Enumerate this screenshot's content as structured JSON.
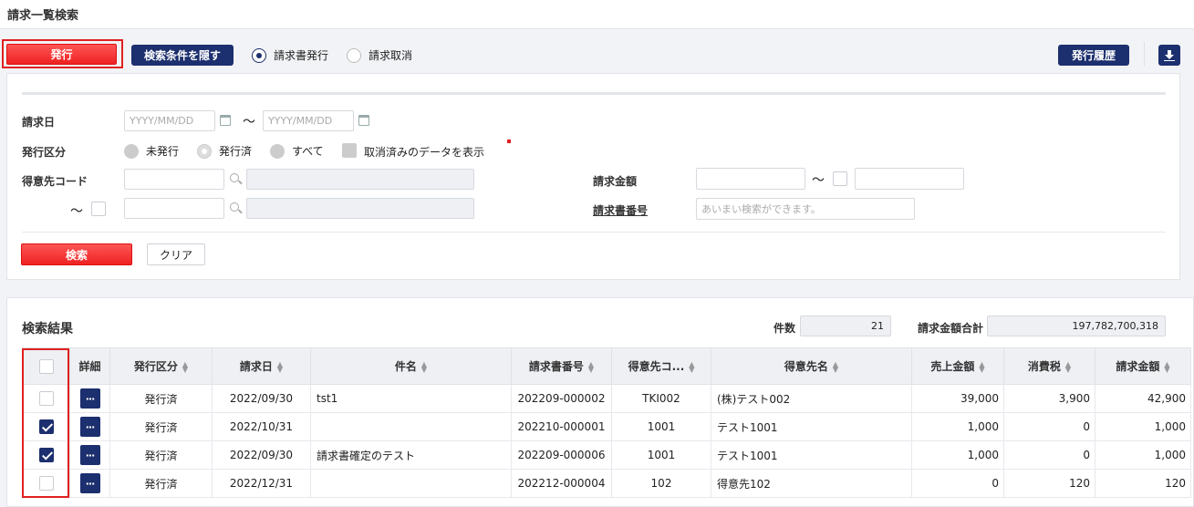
{
  "page_title": "請求一覧検索",
  "toolbar": {
    "issue_button": "発行",
    "hide_conditions_button": "検索条件を隠す",
    "mode_issue": "請求書発行",
    "mode_cancel": "請求取消",
    "history_button": "発行履歴"
  },
  "search": {
    "date_label": "請求日",
    "date_from_placeholder": "YYYY/MM/DD",
    "date_to_placeholder": "YYYY/MM/DD",
    "tilde": "〜",
    "status_label": "発行区分",
    "status_unissued": "未発行",
    "status_issued": "発行済",
    "status_all": "すべて",
    "show_cancelled": "取消済みのデータを表示",
    "customer_code_label": "得意先コード",
    "amount_label": "請求金額",
    "invoice_no_label": "請求書番号",
    "invoice_no_placeholder": "あいまい検索ができます。",
    "search_button": "検索",
    "clear_button": "クリア"
  },
  "results": {
    "title": "検索結果",
    "count_label": "件数",
    "count_value": "21",
    "total_label": "請求金額合計",
    "total_value": "197,782,700,318",
    "columns": [
      "詳細",
      "発行区分",
      "請求日",
      "件名",
      "請求書番号",
      "得意先コ...",
      "得意先名",
      "売上金額",
      "消費税",
      "請求金額"
    ],
    "rows": [
      {
        "checked": false,
        "status": "発行済",
        "date": "2022/09/30",
        "subject": "tst1",
        "invoice_no": "202209-000002",
        "customer_code": "TKI002",
        "customer_name": "(株)テスト002",
        "sales": "39,000",
        "tax": "3,900",
        "amount": "42,900"
      },
      {
        "checked": true,
        "status": "発行済",
        "date": "2022/10/31",
        "subject": "",
        "invoice_no": "202210-000001",
        "customer_code": "1001",
        "customer_name": "テスト1001",
        "sales": "1,000",
        "tax": "0",
        "amount": "1,000"
      },
      {
        "checked": true,
        "status": "発行済",
        "date": "2022/09/30",
        "subject": "請求書確定のテスト",
        "invoice_no": "202209-000006",
        "customer_code": "1001",
        "customer_name": "テスト1001",
        "sales": "1,000",
        "tax": "0",
        "amount": "1,000"
      },
      {
        "checked": false,
        "status": "発行済",
        "date": "2022/12/31",
        "subject": "",
        "invoice_no": "202212-000004",
        "customer_code": "102",
        "customer_name": "得意先102",
        "sales": "0",
        "tax": "120",
        "amount": "120"
      }
    ]
  }
}
